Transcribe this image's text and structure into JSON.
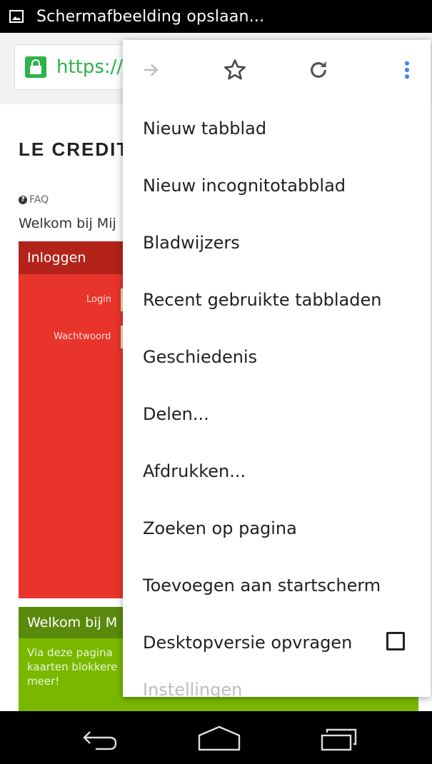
{
  "status_bar": {
    "notification_text": "Schermafbeelding opslaan..."
  },
  "browser": {
    "url_text": "https://"
  },
  "page": {
    "logo_text": "LE CREDIT",
    "faq_label": "FAQ",
    "welcome_line": "Welkom bij Mij",
    "login_panel": {
      "header": "Inloggen",
      "login_label": "Login",
      "password_label": "Wachtwoord"
    },
    "welcome_panel": {
      "header": "Welkom bij M",
      "text": "Via deze pagina kaarten blokkere meer!"
    }
  },
  "menu": {
    "toolbar_icons": [
      "forward-arrow-icon",
      "star-icon",
      "reload-icon",
      "more-vert-icon"
    ],
    "items": [
      {
        "label": "Nieuw tabblad"
      },
      {
        "label": "Nieuw incognitotabblad"
      },
      {
        "label": "Bladwijzers"
      },
      {
        "label": "Recent gebruikte tabbladen"
      },
      {
        "label": "Geschiedenis"
      },
      {
        "label": "Delen..."
      },
      {
        "label": "Afdrukken..."
      },
      {
        "label": "Zoeken op pagina"
      },
      {
        "label": "Toevoegen aan startscherm"
      },
      {
        "label": "Desktopversie opvragen",
        "checkbox": false
      },
      {
        "label": "Instellingen"
      }
    ]
  },
  "nav_bar": {
    "icons": [
      "back-icon",
      "home-icon",
      "recents-icon"
    ]
  },
  "colors": {
    "secure_green": "#2cb34a",
    "login_red": "#e8342a",
    "login_header_red": "#b3231a",
    "welcome_green": "#7ab800",
    "welcome_header_green": "#5a8a0c",
    "accent_blue": "#4285f4"
  }
}
